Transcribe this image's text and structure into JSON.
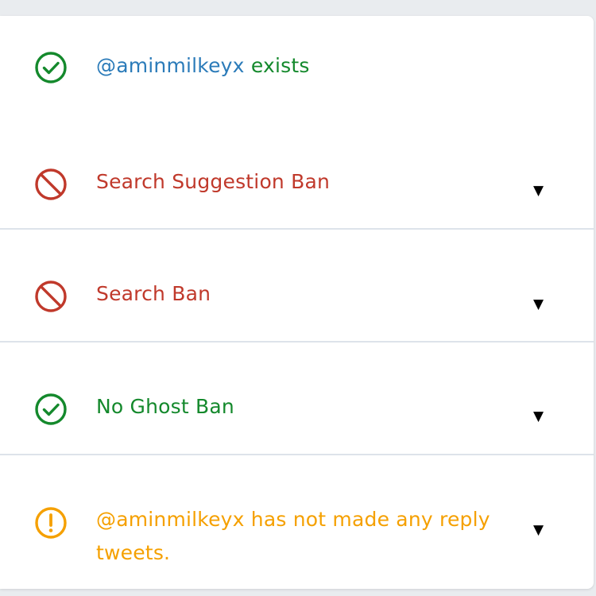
{
  "colors": {
    "ok": "#14892c",
    "ban": "#c0392b",
    "warn": "#f5a000",
    "handle": "#2b7bb9",
    "divider": "#dde3ea"
  },
  "results": {
    "exists": {
      "handle": "@aminmilkeyx",
      "status": "exists",
      "icon": "check-circle-icon"
    },
    "search_suggestion_ban": {
      "label": "Search Suggestion Ban",
      "icon": "ban-icon",
      "expand": "▼"
    },
    "search_ban": {
      "label": "Search Ban",
      "icon": "ban-icon",
      "expand": "▼"
    },
    "ghost_ban": {
      "label": "No Ghost Ban",
      "icon": "check-circle-icon",
      "expand": "▼"
    },
    "reply_deboosting": {
      "label": "@aminmilkeyx has not made any reply tweets.",
      "icon": "warning-circle-icon",
      "expand": "▼"
    }
  }
}
